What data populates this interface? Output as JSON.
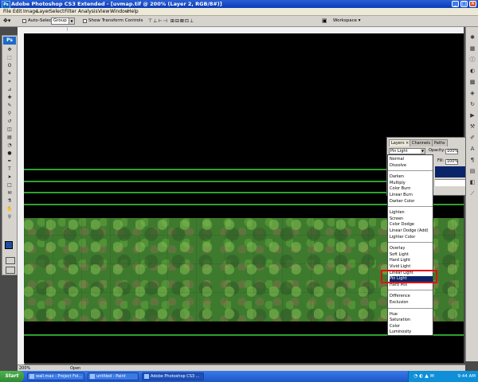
{
  "window": {
    "title": "Adobe Photoshop CS3 Extended - [uvmap.tif @ 200% (Layer 2, RGB/8#)]",
    "app_icon": "Ps",
    "controls": {
      "minimize": "_",
      "maximize": "□",
      "close": "×"
    }
  },
  "menu": [
    "File",
    "Edit",
    "Image",
    "Layer",
    "Select",
    "Filter",
    "Analysis",
    "View",
    "Window",
    "Help"
  ],
  "options_bar": {
    "auto_select_label": "Auto-Select:",
    "auto_select_value": "Group",
    "show_transform_label": "Show Transform Controls",
    "workspace_label": "Workspace ▾"
  },
  "tools": {
    "badge": "Ps",
    "icons": [
      "move-icon",
      "marquee-icon",
      "lasso-icon",
      "magic-wand-icon",
      "crop-icon",
      "slice-icon",
      "healing-icon",
      "brush-icon",
      "stamp-icon",
      "history-brush-icon",
      "eraser-icon",
      "gradient-icon",
      "blur-icon",
      "dodge-icon",
      "pen-icon",
      "type-icon",
      "path-select-icon",
      "shape-icon",
      "notes-icon",
      "eyedropper-icon",
      "hand-icon",
      "zoom-icon"
    ],
    "glyphs": [
      "✥",
      "⬚",
      "ʘ",
      "✶",
      "⌗",
      "⊿",
      "✚",
      "✎",
      "⚲",
      "↺",
      "◫",
      "▤",
      "◔",
      "●",
      "✒",
      "T",
      "➤",
      "□",
      "✉",
      "⚗",
      "✋",
      "⚲"
    ]
  },
  "right_strip_icons": [
    "navigator-icon",
    "histogram-icon",
    "info-icon",
    "color-icon",
    "swatches-icon",
    "styles-icon",
    "history-icon",
    "actions-icon",
    "tool-presets-icon",
    "brushes-icon",
    "character-icon",
    "paragraph-icon",
    "layers-icon",
    "channels-icon",
    "paths-icon"
  ],
  "right_strip_glyphs": [
    "✱",
    "▦",
    "ⓘ",
    "◐",
    "▩",
    "◈",
    "↻",
    "▶",
    "⚒",
    "✐",
    "A",
    "¶",
    "▤",
    "◧",
    "⟋"
  ],
  "layers_panel": {
    "tabs": [
      "Layers ×",
      "Channels",
      "Paths"
    ],
    "blend_mode": "Pin Light",
    "opacity_label": "Opacity:",
    "opacity_value": "100%",
    "fill_label": "Fill:",
    "fill_value": "100%"
  },
  "blend_modes": {
    "groups": [
      [
        "Normal",
        "Dissolve"
      ],
      [
        "Darken",
        "Multiply",
        "Color Burn",
        "Linear Burn",
        "Darker Color"
      ],
      [
        "Lighten",
        "Screen",
        "Color Dodge",
        "Linear Dodge (Add)",
        "Lighter Color"
      ],
      [
        "Overlay",
        "Soft Light",
        "Hard Light",
        "Vivid Light",
        "Linear Light",
        "Pin Light",
        "Hard Mix"
      ],
      [
        "Difference",
        "Exclusion"
      ],
      [
        "Hue",
        "Saturation",
        "Color",
        "Luminosity"
      ]
    ],
    "selected": "Pin Light"
  },
  "status_bar": {
    "zoom": "200%",
    "doc": "Open"
  },
  "taskbar": {
    "start": "Start",
    "items": [
      "wall.max - Project Fol...",
      "untitled - Paint",
      "Adobe Photoshop CS3 ..."
    ],
    "active_index": 2,
    "clock": "9:44 AM"
  },
  "colors": {
    "accent": "#0a246a",
    "grass": "#3d7a2e",
    "guide_line": "#2fa12f",
    "highlight_box": "#e01010"
  }
}
